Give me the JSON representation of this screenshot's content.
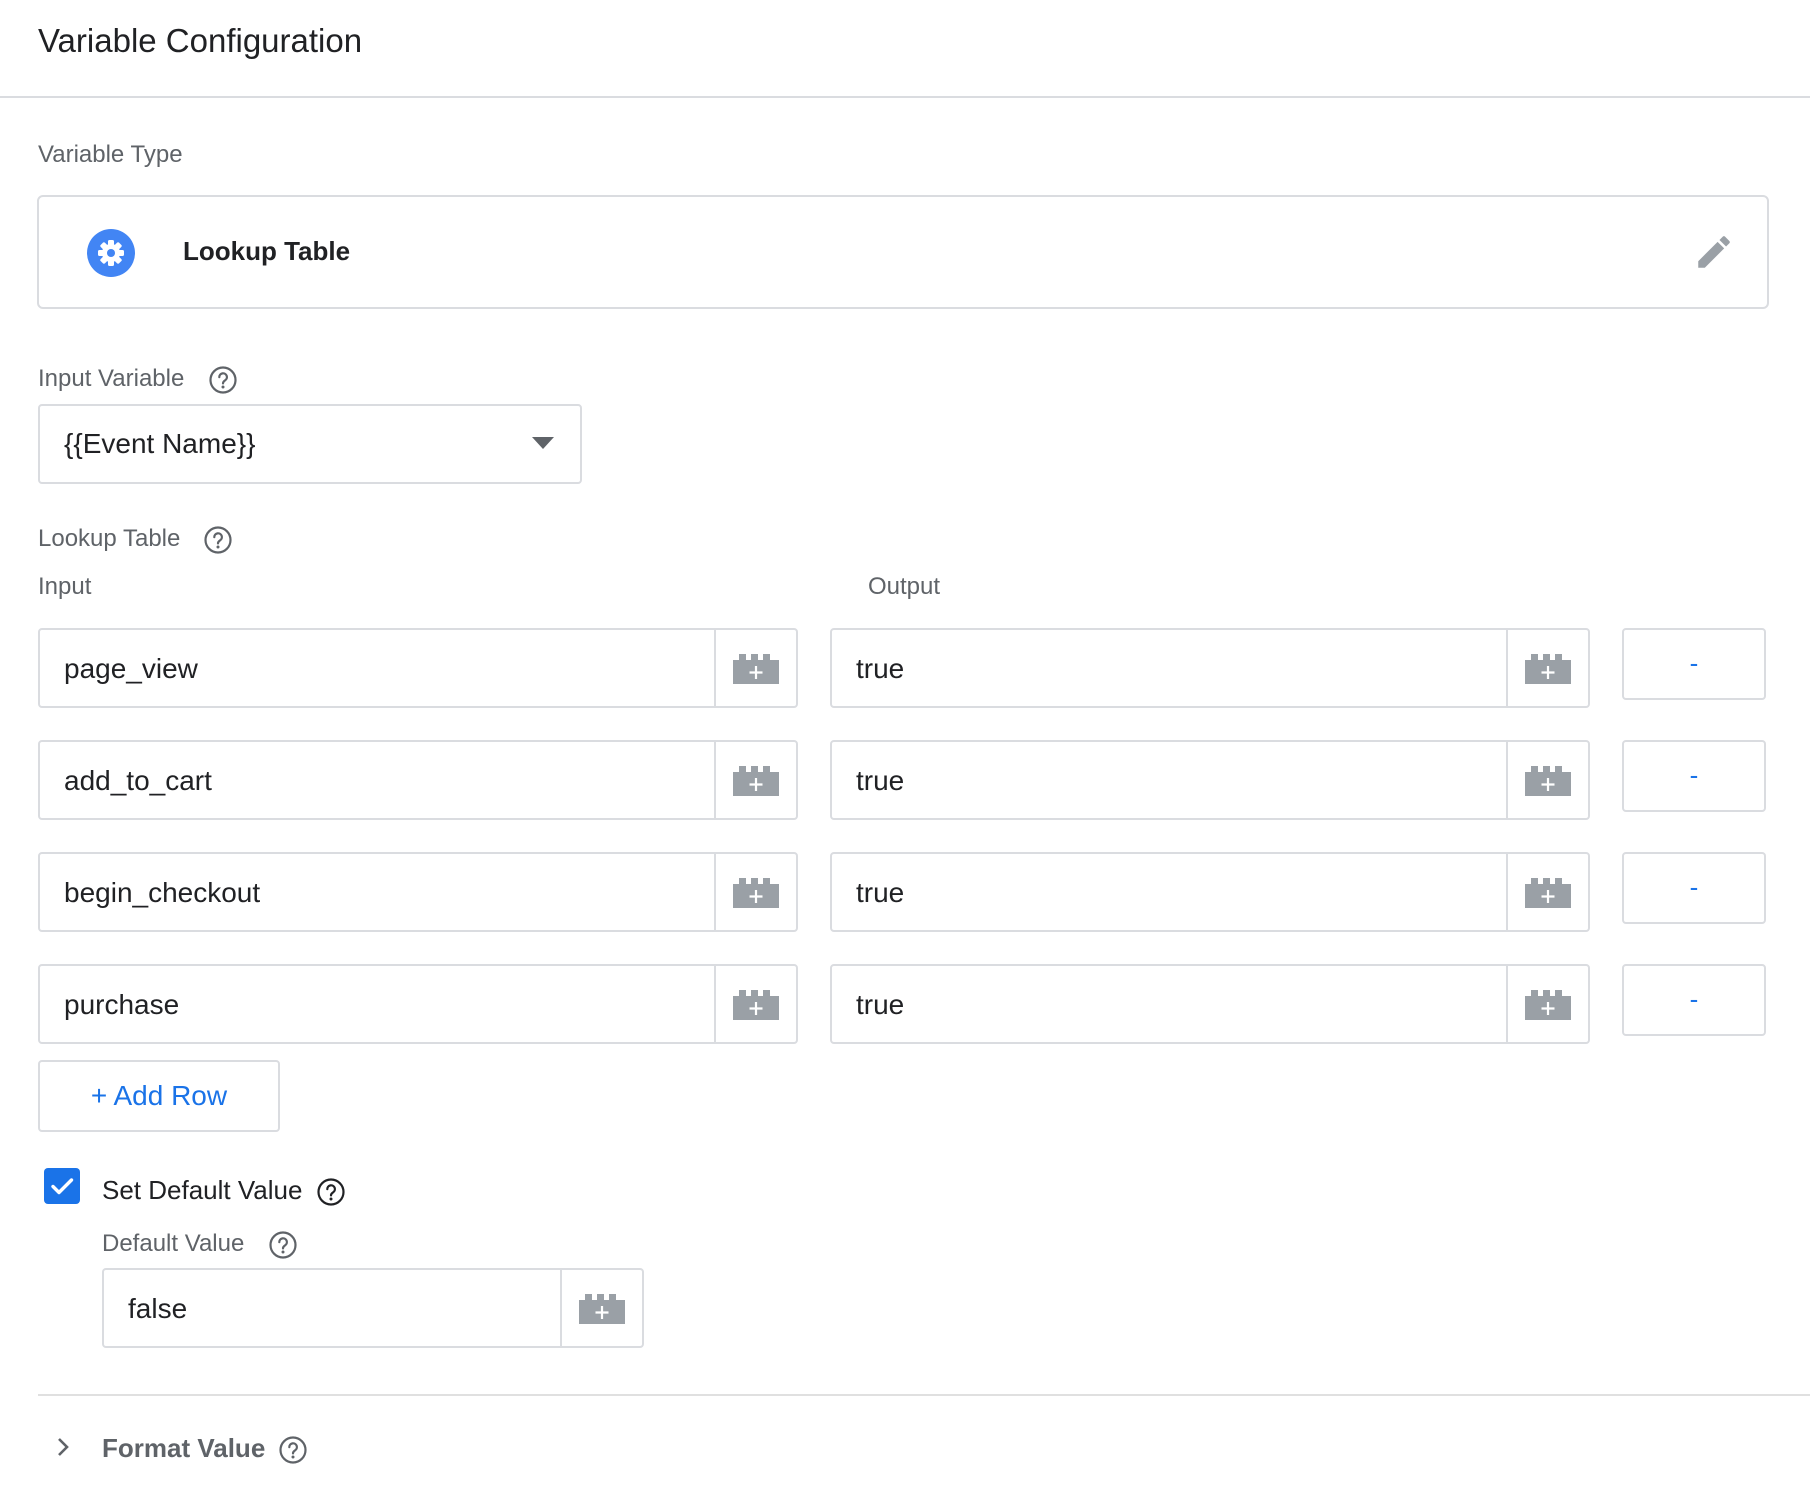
{
  "header": {
    "title": "Variable Configuration"
  },
  "variable_type": {
    "label": "Variable Type",
    "value": "Lookup Table",
    "icon": "gear-icon",
    "edit_icon": "pencil-icon",
    "accent_color": "#4285f4"
  },
  "input_variable": {
    "label": "Input Variable",
    "value": "{{Event Name}}"
  },
  "lookup_table": {
    "label": "Lookup Table",
    "input_header": "Input",
    "output_header": "Output",
    "rows": [
      {
        "input": "page_view",
        "output": "true",
        "remove_label": "-"
      },
      {
        "input": "add_to_cart",
        "output": "true",
        "remove_label": "-"
      },
      {
        "input": "begin_checkout",
        "output": "true",
        "remove_label": "-"
      },
      {
        "input": "purchase",
        "output": "true",
        "remove_label": "-"
      }
    ],
    "add_row_label": "+ Add Row"
  },
  "default_value": {
    "checkbox_label": "Set Default Value",
    "checked": true,
    "field_label": "Default Value",
    "value": "false"
  },
  "format_value": {
    "label": "Format Value"
  },
  "colors": {
    "link_blue": "#1a73e8",
    "border": "#dadce0",
    "label_gray": "#5f6368"
  }
}
